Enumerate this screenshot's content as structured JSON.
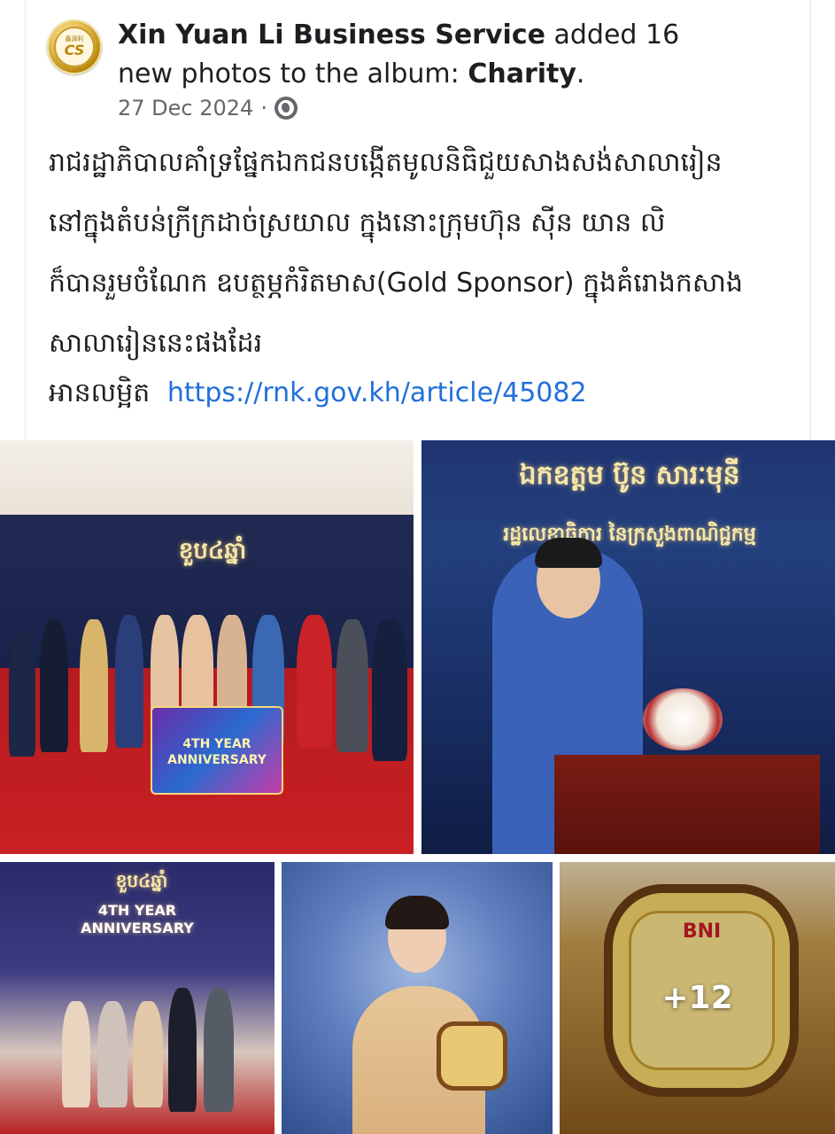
{
  "post": {
    "page_name": "Xin Yuan Li Business Service",
    "action_text": "added 16 new photos to the album:",
    "album_name": "Charity",
    "date": "27 Dec 2024",
    "separator": "·",
    "body": "រាជរដ្ឋាភិបាលគាំទ្រផ្នែកឯកជនបង្កើតមូលនិធិជួយសាងសង់សាលារៀន\nនៅក្នុងតំបន់ក្រីក្រដាច់ស្រយាល ក្នុងនោះក្រុមហ៊ុន ស៊ីន យាន លិ\nក៏បានរួមចំណែក ឧបត្ថម្ភកំរិតមាស(Gold Sponsor) ក្នុងគំរោងកសាង\nសាលារៀននេះផងដែរ",
    "read_more_label": "អានលម្អិត",
    "link": "https://rnk.gov.kh/article/45082"
  },
  "avatar": {
    "top_text": "鑫源利",
    "mono": "CS"
  },
  "photos": {
    "p1_sign_top": "ខួប៤ឆ្នាំ",
    "p1_sign_main": "4TH YEAR ANNIVERSARY",
    "p2_title": "ឯកឧត្តម ប៊ូន សារៈមុនី",
    "p2_subtitle": "រដ្ឋលេខាធិការ នៃក្រសួងពាណិជ្ជកម្ម",
    "p3_sign_top": "ខួប៤ឆ្នាំ",
    "p3_sign_main": "4TH YEAR ANNIVERSARY",
    "p5_brand": "BNI",
    "more_count": "+12"
  }
}
